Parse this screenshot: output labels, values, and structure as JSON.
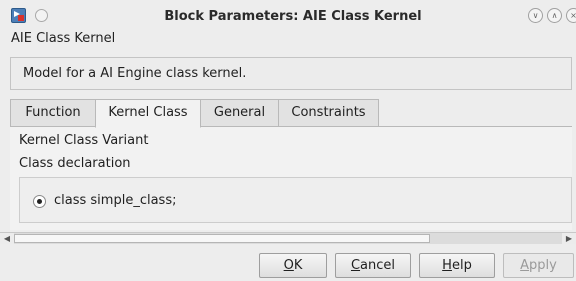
{
  "window": {
    "title": "Block Parameters: AIE Class Kernel",
    "caption": "AIE Class Kernel",
    "controls": [
      "minimize-icon",
      "maximize-icon",
      "close-icon"
    ]
  },
  "description": "Model for a AI Engine class kernel.",
  "tabs": [
    {
      "label": "Function",
      "active": false
    },
    {
      "label": "Kernel Class",
      "active": true
    },
    {
      "label": "General",
      "active": false
    },
    {
      "label": "Constraints",
      "active": false
    }
  ],
  "panel": {
    "variant_label": "Kernel Class Variant",
    "declaration_label": "Class declaration",
    "option": {
      "label": "class simple_class;",
      "selected": true
    }
  },
  "buttons": {
    "ok": {
      "first": "O",
      "rest": "K"
    },
    "cancel": {
      "first": "C",
      "rest": "ancel"
    },
    "help": {
      "first": "H",
      "rest": "elp"
    },
    "apply": {
      "first": "A",
      "rest": "pply",
      "enabled": false
    }
  }
}
